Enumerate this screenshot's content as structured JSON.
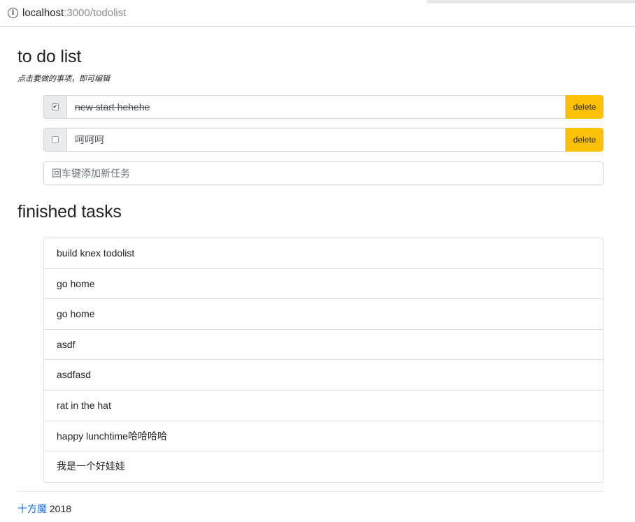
{
  "browser": {
    "url_host": "localhost",
    "url_rest": ":3000/todolist"
  },
  "page": {
    "title": "to do list",
    "hint": "点击要做的事项，即可编辑",
    "todos": [
      {
        "text": "new start hehehe",
        "checked": true,
        "delete_label": "delete"
      },
      {
        "text": "呵呵呵",
        "checked": false,
        "delete_label": "delete"
      }
    ],
    "new_task_placeholder": "回车键添加新任务",
    "finished_title": "finished tasks",
    "finished_tasks": [
      "build knex todolist",
      "go home",
      "go home",
      "asdf",
      "asdfasd",
      "rat in the hat",
      "happy lunchtime哈哈哈哈",
      "我是一个好娃娃"
    ],
    "footer": {
      "author": "十方魔",
      "year": " 2018"
    }
  },
  "colors": {
    "delete_button": "#ffc107",
    "author_link": "#1a6fe0"
  }
}
